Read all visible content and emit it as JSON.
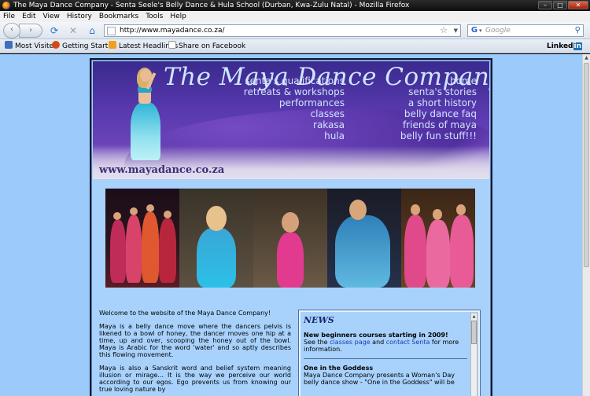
{
  "window": {
    "title": "The Maya Dance Company - Senta Seele's Belly Dance & Hula School (Durban, Kwa-Zulu Natal) - Mozilla Firefox",
    "controls": [
      "–",
      "□",
      "✕"
    ]
  },
  "menubar": [
    "File",
    "Edit",
    "View",
    "History",
    "Bookmarks",
    "Tools",
    "Help"
  ],
  "toolbar": {
    "url": "http://www.mayadance.co.za/",
    "search_placeholder": "Google",
    "search_engine_letter": "G"
  },
  "bookmarks": [
    {
      "label": "Most Visited",
      "color": "#3d6fbd"
    },
    {
      "label": "Getting Started",
      "color": "#d24a1a"
    },
    {
      "label": "Latest Headlines",
      "color": "#f0a020"
    },
    {
      "label": "Share on Facebook",
      "color": "#ffffff"
    }
  ],
  "linkedin": {
    "pre": "Linked",
    "in": "in"
  },
  "banner": {
    "title": "The Maya Dance Company",
    "site": "www.mayadance.co.za",
    "menu_left": [
      "senta's qualifications",
      "retreats & workshops",
      "performances",
      "classes",
      "rakasa",
      "hula"
    ],
    "menu_right": [
      "home",
      "senta's stories",
      "a short history",
      "belly dance faq",
      "friends of maya",
      "belly fun stuff!!!"
    ]
  },
  "content": {
    "welcome": "Welcome to the website of the Maya Dance Company!",
    "p1": "Maya is a belly dance move where the dancers pelvis is likened to a bowl of honey, the dancer moves one hip at a time, up and over, scooping the honey out of the bowl. Maya is Arabic for the word 'water' and so aptly describes this flowing movement.",
    "p2": "Maya is also a Sanskrit word and belief system meaning illusion or mirage... It is the way we perceive our world according to our egos. Ego prevents us from knowing our true loving nature by"
  },
  "news": {
    "heading": "NEWS",
    "item1_title": "New beginners courses starting in 2009!",
    "item1_pre": "See the ",
    "item1_link1": "classes page",
    "item1_mid": " and ",
    "item1_link2": "contact Senta",
    "item1_post": " for more information.",
    "item2_title": "One in the Goddess",
    "item2_text": "Maya Dance Company presents a Woman's Day belly dance show - \"One in the Goddess\" will be"
  },
  "colors": {
    "page_bg": "#9ccbfb",
    "banner_text": "#cfe6ff",
    "link": "#1a3ab3",
    "news_heading": "#1b2870"
  }
}
